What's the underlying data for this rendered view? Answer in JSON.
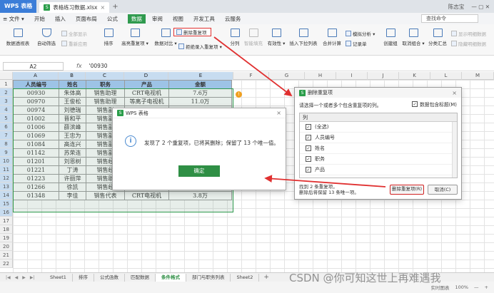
{
  "titlebar": {
    "app": "WPS 表格",
    "doc_tab": "表格练习数据.xlsx",
    "close": "×",
    "add": "+",
    "user": "陈志宝",
    "win_controls": "— ▢ ✕"
  },
  "menu": {
    "file": "≡ 文件 ▾",
    "items": [
      "开始",
      "插入",
      "页面布局",
      "公式",
      "数据",
      "审阅",
      "视图",
      "开发工具",
      "云服务"
    ],
    "active": "数据",
    "search_placeholder": "查找命令"
  },
  "ribbon": {
    "pivot": "数据透视表",
    "autofilter": "自动筛选",
    "show_all": "全部显示",
    "reapply": "重新应用",
    "sort": "排序",
    "highlight_dup": "高亮重复项 ▾",
    "compare": "数据对比 ▾",
    "delete_dup": "删除重复项",
    "reject_dup": "拒绝录入重复项 ▾",
    "split": "分列",
    "smart_fill": "智能填充",
    "validity": "有效性 ▾",
    "dropdown": "插入下拉列表",
    "merge_calc": "合并计算",
    "simulate": "模拟分析 ▾",
    "record": "记录单",
    "create_group": "创建组",
    "ungroup": "取消组合 ▾",
    "subtotal": "分类汇总",
    "show_detail": "显示明细数据",
    "hide_detail": "隐藏明细数据"
  },
  "formula": {
    "cell": "A2",
    "fx": "fx",
    "value": "'00930"
  },
  "columns": [
    "A",
    "B",
    "C",
    "D",
    "E",
    "F",
    "G",
    "H",
    "I",
    "J",
    "K",
    "L",
    "M"
  ],
  "rows": [
    "1",
    "2",
    "3",
    "4",
    "5",
    "6",
    "7",
    "8",
    "9",
    "10",
    "11",
    "12",
    "13",
    "14",
    "15",
    "16",
    "17",
    "18",
    "19",
    "20",
    "21",
    "22"
  ],
  "table": {
    "headers": [
      "人员编号",
      "姓名",
      "职务",
      "产品",
      "金额"
    ],
    "rows": [
      [
        "00930",
        "朱体高",
        "销售助理",
        "CRT电视机",
        "7.6万"
      ],
      [
        "00970",
        "王俊松",
        "销售助理",
        "等离子电视机",
        "11.0万"
      ],
      [
        "00974",
        "刘德瑞",
        "销售副",
        "",
        ""
      ],
      [
        "01002",
        "晋和平",
        "销售副",
        "",
        ""
      ],
      [
        "01006",
        "薛滨峰",
        "销售副",
        "",
        ""
      ],
      [
        "01069",
        "王忠为",
        "销售副",
        "",
        ""
      ],
      [
        "01084",
        "高连兴",
        "销售副",
        "",
        ""
      ],
      [
        "01142",
        "苏荣连",
        "销售副",
        "",
        ""
      ],
      [
        "01201",
        "刘恩树",
        "销售经",
        "",
        ""
      ],
      [
        "01221",
        "丁涛",
        "销售经",
        "",
        ""
      ],
      [
        "01223",
        "许丽萍",
        "销售助",
        "",
        ""
      ],
      [
        "01266",
        "徐凯",
        "销售经",
        "",
        ""
      ],
      [
        "01348",
        "李佳",
        "销售代表",
        "CRT电视机",
        "3.8万"
      ]
    ]
  },
  "msg_dialog": {
    "title": "WPS 表格",
    "close": "×",
    "info_icon": "i",
    "text": "发现了 2 个重复项，已将其删除；保留了 13 个唯一值。",
    "ok": "确定"
  },
  "dup_dialog": {
    "title": "删除重复项",
    "close": "×",
    "prompt": "请选择一个或者多个包含重复项的列。",
    "has_header": "数据包含标题(M)",
    "list_header": "列",
    "items": [
      "(全选)",
      "人员编号",
      "姓名",
      "职务",
      "产品"
    ],
    "status_line1": "找到 2 条重复项，",
    "status_line2": "删除后将保留 13 条唯一项。",
    "delete_btn": "删除重复项(R)",
    "cancel_btn": "取消(C)",
    "check": "✓"
  },
  "sheets": {
    "nav": [
      "|◀",
      "◀",
      "▶",
      "▶|"
    ],
    "tabs": [
      "Sheet1",
      "排序",
      "公式函数",
      "匹配数据",
      "条件格式",
      "部门与职务列表",
      "Sheet2"
    ],
    "active": "条件格式",
    "add": "+"
  },
  "status": {
    "view": "实时图表",
    "zoom": "100%",
    "minus": "—",
    "plus": "+"
  },
  "watermark": "CSDN @你可知这世上再难遇我",
  "colors": {
    "accent": "#2f9a4e",
    "header_fill": "#9dc3e6",
    "annotation": "#e03030"
  }
}
